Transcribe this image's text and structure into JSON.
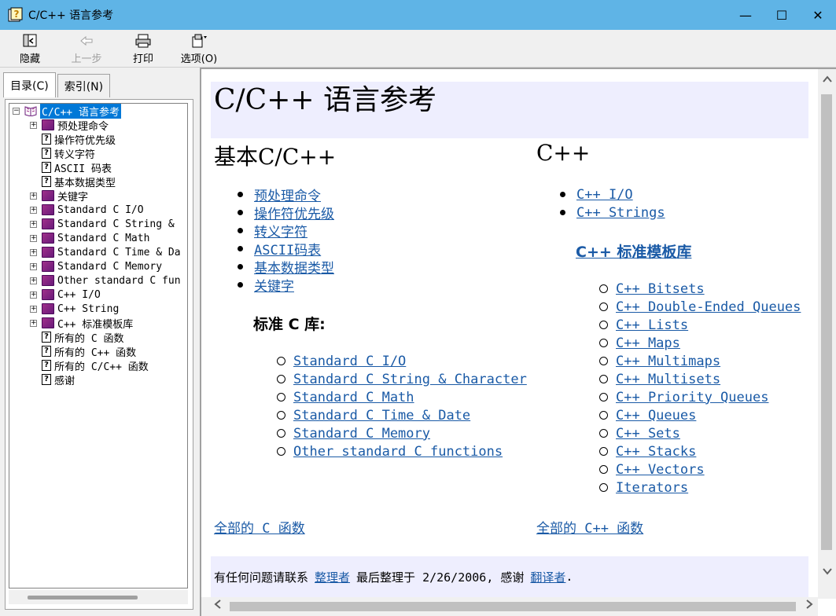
{
  "window": {
    "title": "C/C++ 语言参考",
    "controls": {
      "minimize": "—",
      "maximize": "☐",
      "close": "✕"
    }
  },
  "toolbar": {
    "hide_label": "隐藏",
    "back_label": "上一步",
    "print_label": "打印",
    "options_label": "选项(O)"
  },
  "left_tabs": {
    "contents": "目录(C)",
    "index": "索引(N)"
  },
  "tree": {
    "items": [
      {
        "label": "C/C++ 语言参考",
        "type": "book-open",
        "level": 0,
        "expander": "−",
        "selected": true
      },
      {
        "label": "预处理命令",
        "type": "book",
        "level": 1,
        "expander": "+"
      },
      {
        "label": "操作符优先级",
        "type": "page",
        "level": 1,
        "expander": ""
      },
      {
        "label": "转义字符",
        "type": "page",
        "level": 1,
        "expander": ""
      },
      {
        "label": "ASCII 码表",
        "type": "page",
        "level": 1,
        "expander": ""
      },
      {
        "label": "基本数据类型",
        "type": "page",
        "level": 1,
        "expander": ""
      },
      {
        "label": "关键字",
        "type": "book",
        "level": 1,
        "expander": "+"
      },
      {
        "label": "Standard C I/O",
        "type": "book",
        "level": 1,
        "expander": "+"
      },
      {
        "label": "Standard C String &",
        "type": "book",
        "level": 1,
        "expander": "+"
      },
      {
        "label": "Standard C Math",
        "type": "book",
        "level": 1,
        "expander": "+"
      },
      {
        "label": "Standard C Time & Da",
        "type": "book",
        "level": 1,
        "expander": "+"
      },
      {
        "label": "Standard C Memory",
        "type": "book",
        "level": 1,
        "expander": "+"
      },
      {
        "label": "Other standard C fun",
        "type": "book",
        "level": 1,
        "expander": "+"
      },
      {
        "label": "C++ I/O",
        "type": "book",
        "level": 1,
        "expander": "+"
      },
      {
        "label": "C++ String",
        "type": "book",
        "level": 1,
        "expander": "+"
      },
      {
        "label": "C++ 标准模板库",
        "type": "book",
        "level": 1,
        "expander": "+"
      },
      {
        "label": "所有的 C 函数",
        "type": "page",
        "level": 1,
        "expander": ""
      },
      {
        "label": "所有的 C++ 函数",
        "type": "page",
        "level": 1,
        "expander": ""
      },
      {
        "label": "所有的 C/C++ 函数",
        "type": "page",
        "level": 1,
        "expander": ""
      },
      {
        "label": "感谢",
        "type": "page",
        "level": 1,
        "expander": ""
      }
    ]
  },
  "content": {
    "page_title": "C/C++ 语言参考",
    "left_heading": "基本C/C++",
    "left_links": [
      "预处理命令",
      "操作符优先级",
      "转义字符",
      "ASCII码表",
      "基本数据类型",
      "关键字"
    ],
    "std_c_heading": "标准 C 库:",
    "std_c_links": [
      "Standard C I/O",
      "Standard C String & Character",
      "Standard C Math",
      "Standard C Time & Date",
      "Standard C Memory",
      "Other standard C functions"
    ],
    "all_c_link": "全部的 C 函数",
    "right_heading": "C++",
    "cpp_links": [
      "C++ I/O",
      "C++ Strings"
    ],
    "stl_heading": "C++ 标准模板库",
    "stl_links": [
      "C++ Bitsets",
      "C++ Double-Ended Queues",
      "C++ Lists",
      "C++ Maps",
      "C++ Multimaps",
      "C++ Multisets",
      "C++ Priority Queues",
      "C++ Queues",
      "C++ Sets",
      "C++ Stacks",
      "C++ Vectors",
      "Iterators"
    ],
    "all_cpp_link": "全部的 C++ 函数",
    "footer": {
      "prefix": "有任何问题请联系",
      "maintainer_link": "整理者",
      "middle": "最后整理于 2/26/2006, 感谢",
      "translator_link": "翻译者",
      "suffix": "."
    }
  },
  "colors": {
    "titlebar": "#5fb4e6",
    "link": "#1a5aa6",
    "panel_bg": "#eeeefe",
    "selection": "#0078d7"
  }
}
